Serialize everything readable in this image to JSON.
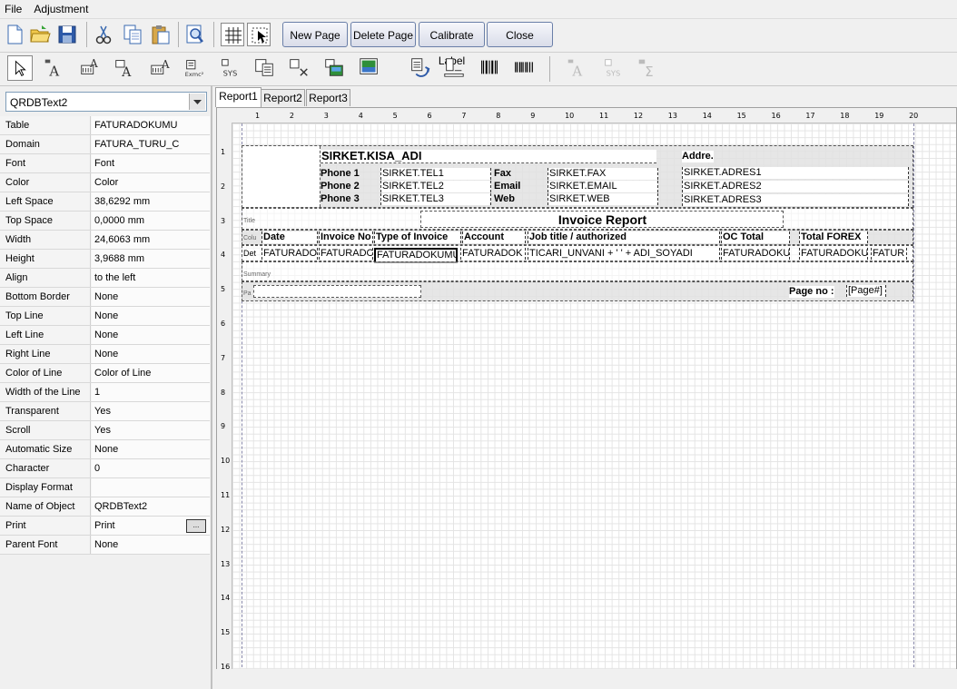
{
  "menu": {
    "file": "File",
    "adjustment": "Adjustment"
  },
  "toolbar": {
    "new_page": "New Page",
    "delete_page": "Delete Page",
    "calibrate_label": "Calibrate Label",
    "close": "Close"
  },
  "component_select": {
    "value": "QRDBText2"
  },
  "properties": [
    {
      "name": "Table",
      "value": "FATURADOKUMU"
    },
    {
      "name": "Domain",
      "value": "FATURA_TURU_C"
    },
    {
      "name": "Font",
      "value": "Font"
    },
    {
      "name": "Color",
      "value": "Color"
    },
    {
      "name": "Left Space",
      "value": "38,6292 mm"
    },
    {
      "name": "Top Space",
      "value": "0,0000 mm"
    },
    {
      "name": "Width",
      "value": "24,6063 mm"
    },
    {
      "name": "Height",
      "value": "3,9688 mm"
    },
    {
      "name": "Align",
      "value": "to the left"
    },
    {
      "name": "Bottom Border",
      "value": "None"
    },
    {
      "name": "Top Line",
      "value": "None"
    },
    {
      "name": "Left Line",
      "value": "None"
    },
    {
      "name": "Right Line",
      "value": "None"
    },
    {
      "name": "Color of Line",
      "value": "Color of Line"
    },
    {
      "name": "Width of the Line",
      "value": "1"
    },
    {
      "name": "Transparent",
      "value": "Yes"
    },
    {
      "name": "Scroll",
      "value": "Yes"
    },
    {
      "name": "Automatic Size",
      "value": "None"
    },
    {
      "name": "Character",
      "value": "0"
    },
    {
      "name": "Display Format",
      "value": ""
    },
    {
      "name": "Name of Object",
      "value": "QRDBText2"
    },
    {
      "name": "Print",
      "value": "Print"
    },
    {
      "name": "Parent Font",
      "value": "None"
    }
  ],
  "tabs": [
    "Report1",
    "Report2",
    "Report3"
  ],
  "ruler": {
    "h": [
      "1",
      "2",
      "3",
      "4",
      "5",
      "6",
      "7",
      "8",
      "9",
      "10",
      "11",
      "12",
      "13",
      "14",
      "15",
      "16",
      "17",
      "18",
      "19",
      "20"
    ],
    "v": [
      "1",
      "2",
      "3",
      "4",
      "5",
      "6",
      "7",
      "8",
      "9",
      "10",
      "11",
      "12",
      "13",
      "14",
      "15",
      "16"
    ]
  },
  "report": {
    "company": "SIRKET.KISA_ADI",
    "phone1": "Phone 1",
    "phone2": "Phone 2",
    "phone3": "Phone 3",
    "tel1": "SIRKET.TEL1",
    "tel2": "SIRKET.TEL2",
    "tel3": "SIRKET.TEL3",
    "fax_label": "Fax",
    "email_label": "Email",
    "web_label": "Web",
    "fax": "SIRKET.FAX",
    "email": "SIRKET.EMAIL",
    "web": "SIRKET.WEB",
    "address_label": "Addre.",
    "adres1": "SIRKET.ADRES1",
    "adres2": "SIRKET.ADRES2",
    "adres3": "SIRKET.ADRES3",
    "title_band": "Title",
    "title": "Invoice Report",
    "colhead_band": "Colu",
    "headers": [
      "Date",
      "Invoice No",
      "Type of Invoice",
      "Account",
      "Job title / authorized",
      "OC Total",
      "Total FOREX"
    ],
    "detail_band": "Det",
    "detail": [
      "FATURADO",
      "FATURADO",
      "FATURADOKUMU",
      "FATURADOK",
      "TICARI_UNVANI + ' ' + ADI_SOYADI",
      "FATURADOKU",
      "FATURADOKU",
      "FATUR"
    ],
    "summary_band": "Summary",
    "page_band": "Pa",
    "page_no_label": "Page no :",
    "page_no": "[Page#]"
  },
  "colors": {
    "band": "#e2e2e2",
    "grid": "#e4e4e4",
    "button_border": "#6a7fa8"
  }
}
